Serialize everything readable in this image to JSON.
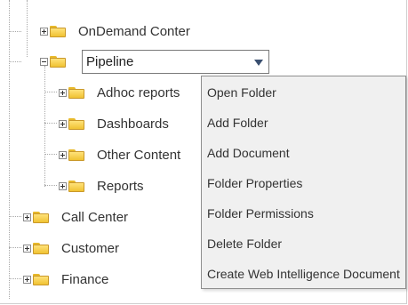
{
  "tree": {
    "ondemand": "OnDemand Conter",
    "pipeline": "Pipeline",
    "children": [
      "Adhoc reports",
      "Dashboards",
      "Other Content",
      "Reports"
    ],
    "roots": [
      "Call Center",
      "Customer",
      "Finance"
    ]
  },
  "context_menu": {
    "items": [
      "Open Folder",
      "Add Folder",
      "Add Document",
      "Folder Properties",
      "Folder Permissions",
      "Delete Folder",
      "Create Web Intelligence Document"
    ]
  },
  "colors": {
    "folder": "#f0c232",
    "menu_background": "#f0f0f0",
    "dropdown_arrow": "#3a4f70"
  }
}
